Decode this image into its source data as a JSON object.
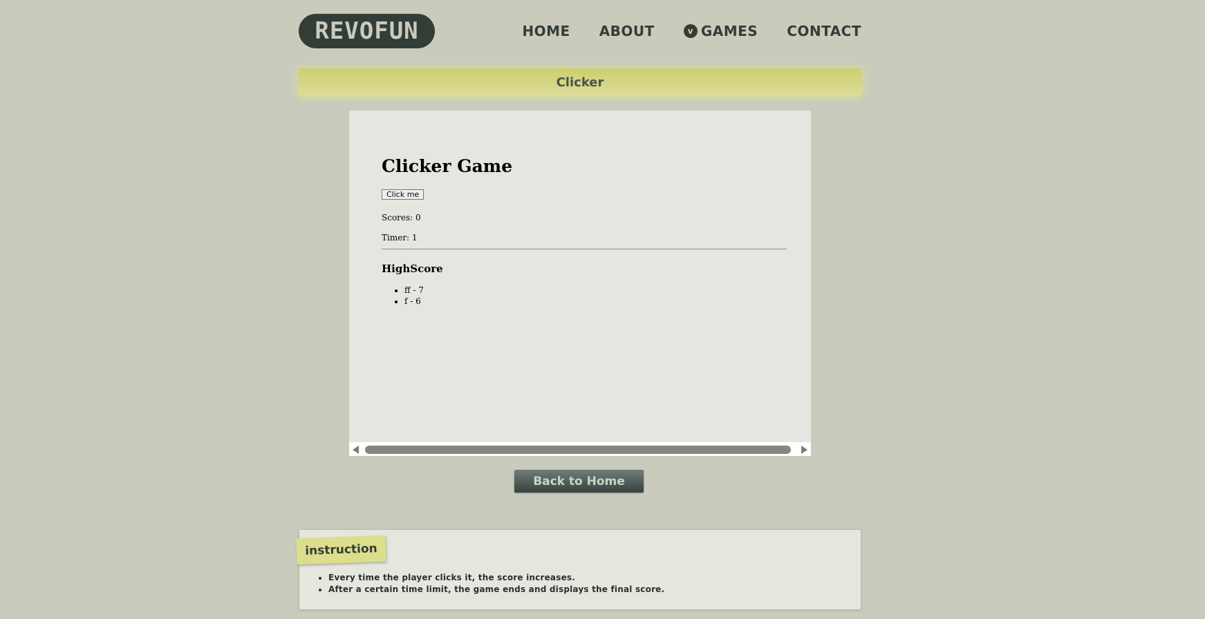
{
  "header": {
    "logo": "REVOFUN",
    "nav": [
      {
        "label": "HOME"
      },
      {
        "label": "ABOUT"
      },
      {
        "label": "GAMES",
        "icon": "chevron-down-icon",
        "icon_glyph": "v"
      },
      {
        "label": "CONTACT"
      }
    ]
  },
  "banner": {
    "title": "Clicker"
  },
  "game": {
    "title": "Clicker Game",
    "button_label": "Click me",
    "scores": "Scores: 0",
    "timer": "Timer: 1",
    "highscore_title": "HighScore",
    "highscores": [
      "ff - 7",
      "f - 6"
    ]
  },
  "back_button": "Back to Home",
  "instruction": {
    "tag": "instruction",
    "items": [
      "Every time the player clicks it, the score increases.",
      "After a certain time limit, the game ends and displays the final score."
    ]
  },
  "colors": {
    "background": "#c9cbbd",
    "dark": "#333d38",
    "accent_yellow": "#dcde8c"
  }
}
